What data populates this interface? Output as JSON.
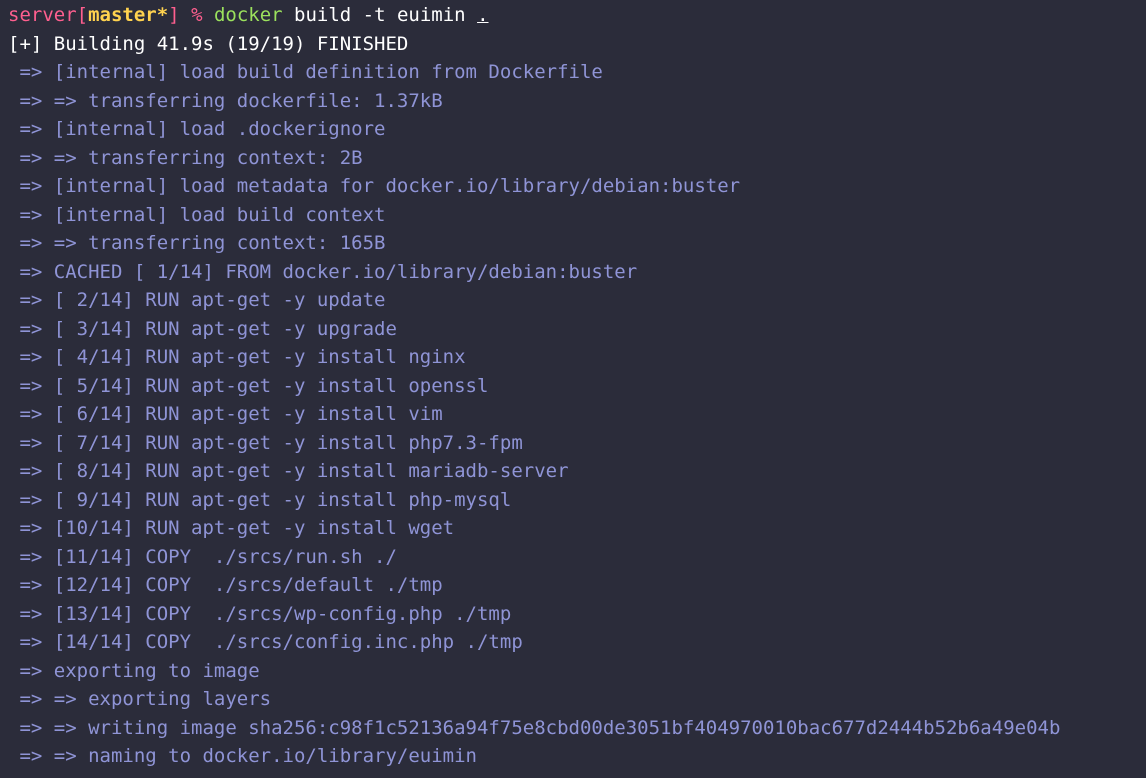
{
  "colors": {
    "background": "#2b2c3a",
    "prompt": "#ff5f8f",
    "branch": "#ffd24f",
    "command": "#9be15d",
    "text": "#ffffff",
    "step": "#8f94d6"
  },
  "prompt": {
    "host": "server",
    "branch_open": "[",
    "branch": "master*",
    "branch_close": "]",
    "symbol": " % ",
    "command": "docker",
    "args": " build -t euimin ",
    "context": "."
  },
  "status_line": "[+] Building 41.9s (19/19) FINISHED",
  "steps": [
    " => [internal] load build definition from Dockerfile",
    " => => transferring dockerfile: 1.37kB",
    " => [internal] load .dockerignore",
    " => => transferring context: 2B",
    " => [internal] load metadata for docker.io/library/debian:buster",
    " => [internal] load build context",
    " => => transferring context: 165B",
    " => CACHED [ 1/14] FROM docker.io/library/debian:buster",
    " => [ 2/14] RUN apt-get -y update",
    " => [ 3/14] RUN apt-get -y upgrade",
    " => [ 4/14] RUN apt-get -y install nginx",
    " => [ 5/14] RUN apt-get -y install openssl",
    " => [ 6/14] RUN apt-get -y install vim",
    " => [ 7/14] RUN apt-get -y install php7.3-fpm",
    " => [ 8/14] RUN apt-get -y install mariadb-server",
    " => [ 9/14] RUN apt-get -y install php-mysql",
    " => [10/14] RUN apt-get -y install wget",
    " => [11/14] COPY  ./srcs/run.sh ./",
    " => [12/14] COPY  ./srcs/default ./tmp",
    " => [13/14] COPY  ./srcs/wp-config.php ./tmp",
    " => [14/14] COPY  ./srcs/config.inc.php ./tmp",
    " => exporting to image",
    " => => exporting layers",
    " => => writing image sha256:c98f1c52136a94f75e8cbd00de3051bf404970010bac677d2444b52b6a49e04b",
    " => => naming to docker.io/library/euimin"
  ]
}
